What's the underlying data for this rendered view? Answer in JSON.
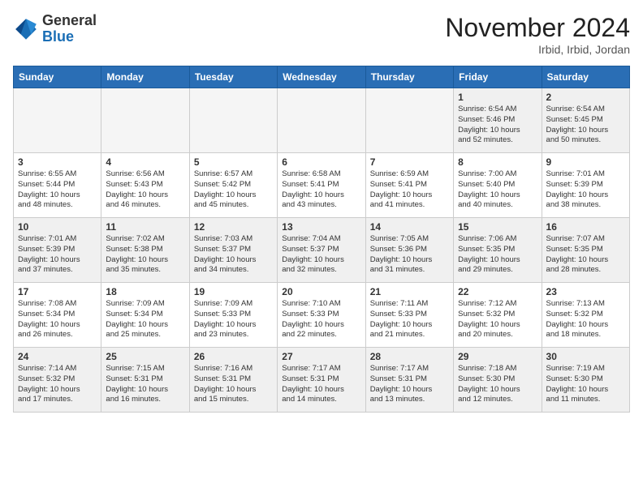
{
  "header": {
    "logo_general": "General",
    "logo_blue": "Blue",
    "month_title": "November 2024",
    "location": "Irbid, Irbid, Jordan"
  },
  "weekdays": [
    "Sunday",
    "Monday",
    "Tuesday",
    "Wednesday",
    "Thursday",
    "Friday",
    "Saturday"
  ],
  "weeks": [
    [
      {
        "day": "",
        "info": ""
      },
      {
        "day": "",
        "info": ""
      },
      {
        "day": "",
        "info": ""
      },
      {
        "day": "",
        "info": ""
      },
      {
        "day": "",
        "info": ""
      },
      {
        "day": "1",
        "info": "Sunrise: 6:54 AM\nSunset: 5:46 PM\nDaylight: 10 hours\nand 52 minutes."
      },
      {
        "day": "2",
        "info": "Sunrise: 6:54 AM\nSunset: 5:45 PM\nDaylight: 10 hours\nand 50 minutes."
      }
    ],
    [
      {
        "day": "3",
        "info": "Sunrise: 6:55 AM\nSunset: 5:44 PM\nDaylight: 10 hours\nand 48 minutes."
      },
      {
        "day": "4",
        "info": "Sunrise: 6:56 AM\nSunset: 5:43 PM\nDaylight: 10 hours\nand 46 minutes."
      },
      {
        "day": "5",
        "info": "Sunrise: 6:57 AM\nSunset: 5:42 PM\nDaylight: 10 hours\nand 45 minutes."
      },
      {
        "day": "6",
        "info": "Sunrise: 6:58 AM\nSunset: 5:41 PM\nDaylight: 10 hours\nand 43 minutes."
      },
      {
        "day": "7",
        "info": "Sunrise: 6:59 AM\nSunset: 5:41 PM\nDaylight: 10 hours\nand 41 minutes."
      },
      {
        "day": "8",
        "info": "Sunrise: 7:00 AM\nSunset: 5:40 PM\nDaylight: 10 hours\nand 40 minutes."
      },
      {
        "day": "9",
        "info": "Sunrise: 7:01 AM\nSunset: 5:39 PM\nDaylight: 10 hours\nand 38 minutes."
      }
    ],
    [
      {
        "day": "10",
        "info": "Sunrise: 7:01 AM\nSunset: 5:39 PM\nDaylight: 10 hours\nand 37 minutes."
      },
      {
        "day": "11",
        "info": "Sunrise: 7:02 AM\nSunset: 5:38 PM\nDaylight: 10 hours\nand 35 minutes."
      },
      {
        "day": "12",
        "info": "Sunrise: 7:03 AM\nSunset: 5:37 PM\nDaylight: 10 hours\nand 34 minutes."
      },
      {
        "day": "13",
        "info": "Sunrise: 7:04 AM\nSunset: 5:37 PM\nDaylight: 10 hours\nand 32 minutes."
      },
      {
        "day": "14",
        "info": "Sunrise: 7:05 AM\nSunset: 5:36 PM\nDaylight: 10 hours\nand 31 minutes."
      },
      {
        "day": "15",
        "info": "Sunrise: 7:06 AM\nSunset: 5:35 PM\nDaylight: 10 hours\nand 29 minutes."
      },
      {
        "day": "16",
        "info": "Sunrise: 7:07 AM\nSunset: 5:35 PM\nDaylight: 10 hours\nand 28 minutes."
      }
    ],
    [
      {
        "day": "17",
        "info": "Sunrise: 7:08 AM\nSunset: 5:34 PM\nDaylight: 10 hours\nand 26 minutes."
      },
      {
        "day": "18",
        "info": "Sunrise: 7:09 AM\nSunset: 5:34 PM\nDaylight: 10 hours\nand 25 minutes."
      },
      {
        "day": "19",
        "info": "Sunrise: 7:09 AM\nSunset: 5:33 PM\nDaylight: 10 hours\nand 23 minutes."
      },
      {
        "day": "20",
        "info": "Sunrise: 7:10 AM\nSunset: 5:33 PM\nDaylight: 10 hours\nand 22 minutes."
      },
      {
        "day": "21",
        "info": "Sunrise: 7:11 AM\nSunset: 5:33 PM\nDaylight: 10 hours\nand 21 minutes."
      },
      {
        "day": "22",
        "info": "Sunrise: 7:12 AM\nSunset: 5:32 PM\nDaylight: 10 hours\nand 20 minutes."
      },
      {
        "day": "23",
        "info": "Sunrise: 7:13 AM\nSunset: 5:32 PM\nDaylight: 10 hours\nand 18 minutes."
      }
    ],
    [
      {
        "day": "24",
        "info": "Sunrise: 7:14 AM\nSunset: 5:32 PM\nDaylight: 10 hours\nand 17 minutes."
      },
      {
        "day": "25",
        "info": "Sunrise: 7:15 AM\nSunset: 5:31 PM\nDaylight: 10 hours\nand 16 minutes."
      },
      {
        "day": "26",
        "info": "Sunrise: 7:16 AM\nSunset: 5:31 PM\nDaylight: 10 hours\nand 15 minutes."
      },
      {
        "day": "27",
        "info": "Sunrise: 7:17 AM\nSunset: 5:31 PM\nDaylight: 10 hours\nand 14 minutes."
      },
      {
        "day": "28",
        "info": "Sunrise: 7:17 AM\nSunset: 5:31 PM\nDaylight: 10 hours\nand 13 minutes."
      },
      {
        "day": "29",
        "info": "Sunrise: 7:18 AM\nSunset: 5:30 PM\nDaylight: 10 hours\nand 12 minutes."
      },
      {
        "day": "30",
        "info": "Sunrise: 7:19 AM\nSunset: 5:30 PM\nDaylight: 10 hours\nand 11 minutes."
      }
    ]
  ]
}
